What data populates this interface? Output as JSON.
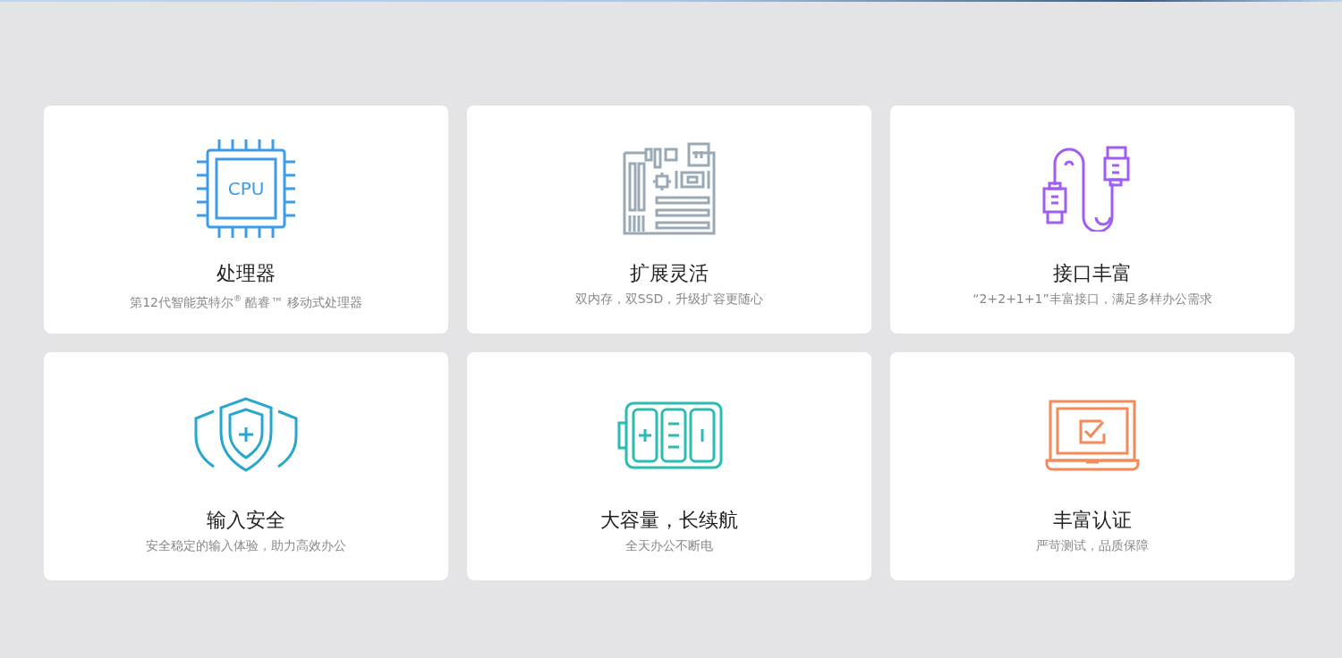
{
  "features": [
    {
      "kind": "cpu",
      "icon_text": "CPU",
      "title": "处理器",
      "subtitle": "第12代智能英特尔$^{®}$ 酷睿™ 移动式处理器"
    },
    {
      "kind": "motherboard",
      "title": "扩展灵活",
      "subtitle": "双内存，双SSD，升级扩容更随心"
    },
    {
      "kind": "cable",
      "title": "接口丰富",
      "subtitle": "“2+2+1+1”丰富接口，满足多样办公需求"
    },
    {
      "kind": "shield",
      "title": "输入安全",
      "subtitle": "安全稳定的输入体验，助力高效办公"
    },
    {
      "kind": "battery",
      "title": "大容量，长续航",
      "subtitle": "全天办公不断电"
    },
    {
      "kind": "laptop",
      "title": "丰富认证",
      "subtitle": "严苛测试，品质保障"
    }
  ]
}
